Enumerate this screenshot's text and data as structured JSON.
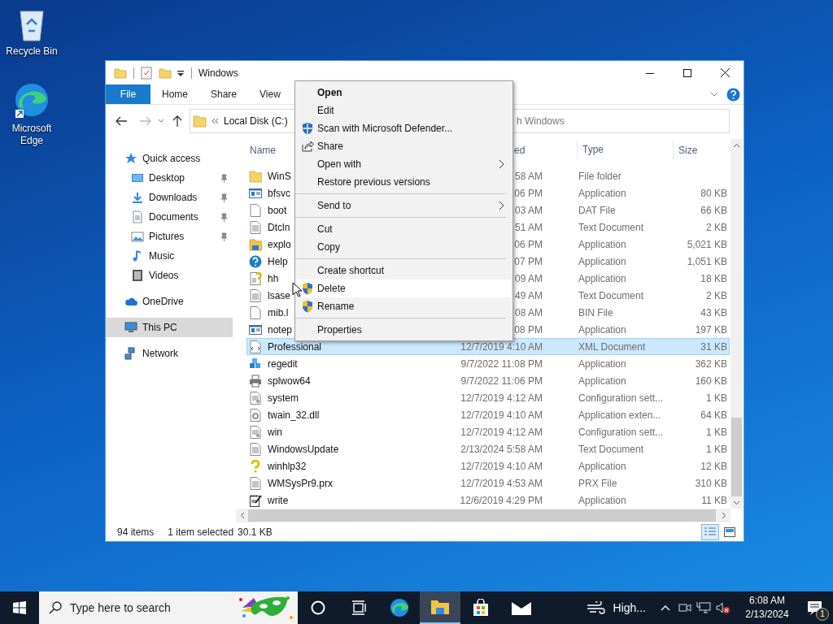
{
  "desktop_icons": [
    {
      "label": "Recycle Bin",
      "kind": "recycle"
    },
    {
      "label": "Microsoft Edge",
      "kind": "edge"
    }
  ],
  "window": {
    "title": "Windows",
    "ribbon_tabs": [
      {
        "label": "File",
        "selected": true
      },
      {
        "label": "Home",
        "selected": false
      },
      {
        "label": "Share",
        "selected": false
      },
      {
        "label": "View",
        "selected": false
      }
    ],
    "address": "Local Disk (C:)",
    "search": {
      "placeholder": "h Windows"
    },
    "nav": [
      {
        "label": "Quick access",
        "kind": "star",
        "selected": false,
        "children": [
          {
            "label": "Desktop",
            "kind": "desktop",
            "pinned": true,
            "selected": false
          },
          {
            "label": "Downloads",
            "kind": "downloads",
            "pinned": true,
            "selected": false
          },
          {
            "label": "Documents",
            "kind": "documents",
            "pinned": true,
            "selected": false
          },
          {
            "label": "Pictures",
            "kind": "pictures",
            "pinned": true,
            "selected": false
          },
          {
            "label": "Music",
            "kind": "music",
            "pinned": false,
            "selected": false
          },
          {
            "label": "Videos",
            "kind": "videos",
            "pinned": false,
            "selected": false
          }
        ]
      },
      {
        "label": "OneDrive",
        "kind": "cloud",
        "selected": false
      },
      {
        "label": "This PC",
        "kind": "pc",
        "selected": true
      },
      {
        "label": "Network",
        "kind": "network",
        "selected": false
      }
    ],
    "columns": [
      "Name",
      "ed",
      "Type",
      "Size"
    ],
    "rows": [
      {
        "name": "WinS",
        "date": "58 AM",
        "type": "File folder",
        "kind": "folder",
        "selected": false
      },
      {
        "name": "bfsvc",
        "date": "06 PM",
        "type": "Application",
        "size": "80 KB",
        "kind": "app",
        "selected": false
      },
      {
        "name": "boot",
        "date": "03 AM",
        "type": "DAT File",
        "size": "66 KB",
        "kind": "blank",
        "selected": false
      },
      {
        "name": "Dtcln",
        "date": "51 AM",
        "type": "Text Document",
        "size": "2 KB",
        "kind": "text",
        "selected": false
      },
      {
        "name": "explo",
        "date": "06 PM",
        "type": "Application",
        "size": "5,021 KB",
        "kind": "explorer",
        "selected": false
      },
      {
        "name": "Help",
        "date": "07 PM",
        "type": "Application",
        "size": "1,051 KB",
        "kind": "help",
        "selected": false
      },
      {
        "name": "hh",
        "date": "09 AM",
        "type": "Application",
        "size": "18 KB",
        "kind": "hh",
        "selected": false
      },
      {
        "name": "lsase",
        "date": "49 AM",
        "type": "Text Document",
        "size": "2 KB",
        "kind": "text",
        "selected": false
      },
      {
        "name": "mib.l",
        "date": "08 AM",
        "type": "BIN File",
        "size": "43 KB",
        "kind": "blank",
        "selected": false
      },
      {
        "name": "notep",
        "date": "08 PM",
        "type": "Application",
        "size": "197 KB",
        "kind": "app",
        "selected": false
      },
      {
        "name": "Professional",
        "date": "12/7/2019 4:10 AM",
        "type": "XML Document",
        "size": "31 KB",
        "kind": "xml",
        "selected": true
      },
      {
        "name": "regedit",
        "date": "9/7/2022 11:08 PM",
        "type": "Application",
        "size": "362 KB",
        "kind": "regedit",
        "selected": false
      },
      {
        "name": "splwow64",
        "date": "9/7/2022 11:06 PM",
        "type": "Application",
        "size": "160 KB",
        "kind": "printer",
        "selected": false
      },
      {
        "name": "system",
        "date": "12/7/2019 4:12 AM",
        "type": "Configuration sett...",
        "size": "1 KB",
        "kind": "config",
        "selected": false
      },
      {
        "name": "twain_32.dll",
        "date": "12/7/2019 4:10 AM",
        "type": "Application exten...",
        "size": "64 KB",
        "kind": "dll",
        "selected": false
      },
      {
        "name": "win",
        "date": "12/7/2019 4:12 AM",
        "type": "Configuration sett...",
        "size": "1 KB",
        "kind": "config",
        "selected": false
      },
      {
        "name": "WindowsUpdate",
        "date": "2/13/2024 5:58 AM",
        "type": "Text Document",
        "size": "1 KB",
        "kind": "text",
        "selected": false
      },
      {
        "name": "winhlp32",
        "date": "12/7/2019 4:10 AM",
        "type": "Application",
        "size": "12 KB",
        "kind": "winhlp",
        "selected": false
      },
      {
        "name": "WMSysPr9.prx",
        "date": "12/7/2019 4:53 AM",
        "type": "PRX File",
        "size": "310 KB",
        "kind": "text",
        "selected": false
      },
      {
        "name": "write",
        "date": "12/6/2019 4:29 PM",
        "type": "Application",
        "size": "11 KB",
        "kind": "write",
        "selected": false
      }
    ],
    "status_bar": {
      "items": "94 items",
      "selection": "1 item selected",
      "size": "30.1 KB"
    }
  },
  "context_menu": [
    {
      "kind": "item",
      "label": "Open",
      "default": true,
      "hovered": false
    },
    {
      "kind": "item",
      "label": "Edit",
      "default": false,
      "hovered": false
    },
    {
      "kind": "item",
      "label": "Scan with Microsoft Defender...",
      "default": false,
      "hovered": false
    },
    {
      "kind": "item",
      "label": "Share",
      "default": false,
      "hovered": false
    },
    {
      "kind": "item",
      "label": "Open with",
      "submenu": true,
      "default": false,
      "hovered": false
    },
    {
      "kind": "item",
      "label": "Restore previous versions",
      "default": false,
      "hovered": false
    },
    {
      "kind": "separator"
    },
    {
      "kind": "item",
      "label": "Send to",
      "submenu": true,
      "default": false,
      "hovered": false
    },
    {
      "kind": "separator"
    },
    {
      "kind": "item",
      "label": "Cut",
      "default": false,
      "hovered": false
    },
    {
      "kind": "item",
      "label": "Copy",
      "default": false,
      "hovered": false
    },
    {
      "kind": "separator"
    },
    {
      "kind": "item",
      "label": "Create shortcut",
      "default": false,
      "hovered": false
    },
    {
      "kind": "item",
      "label": "Delete",
      "default": false,
      "hovered": true
    },
    {
      "kind": "item",
      "label": "Rename",
      "default": false,
      "hovered": false
    },
    {
      "kind": "separator"
    },
    {
      "kind": "item",
      "label": "Properties",
      "default": false,
      "hovered": false
    }
  ],
  "taskbar": {
    "search_placeholder": "Type here to search",
    "weather": "High...",
    "time": "6:08 AM",
    "date": "2/13/2024",
    "notifications": "1"
  }
}
